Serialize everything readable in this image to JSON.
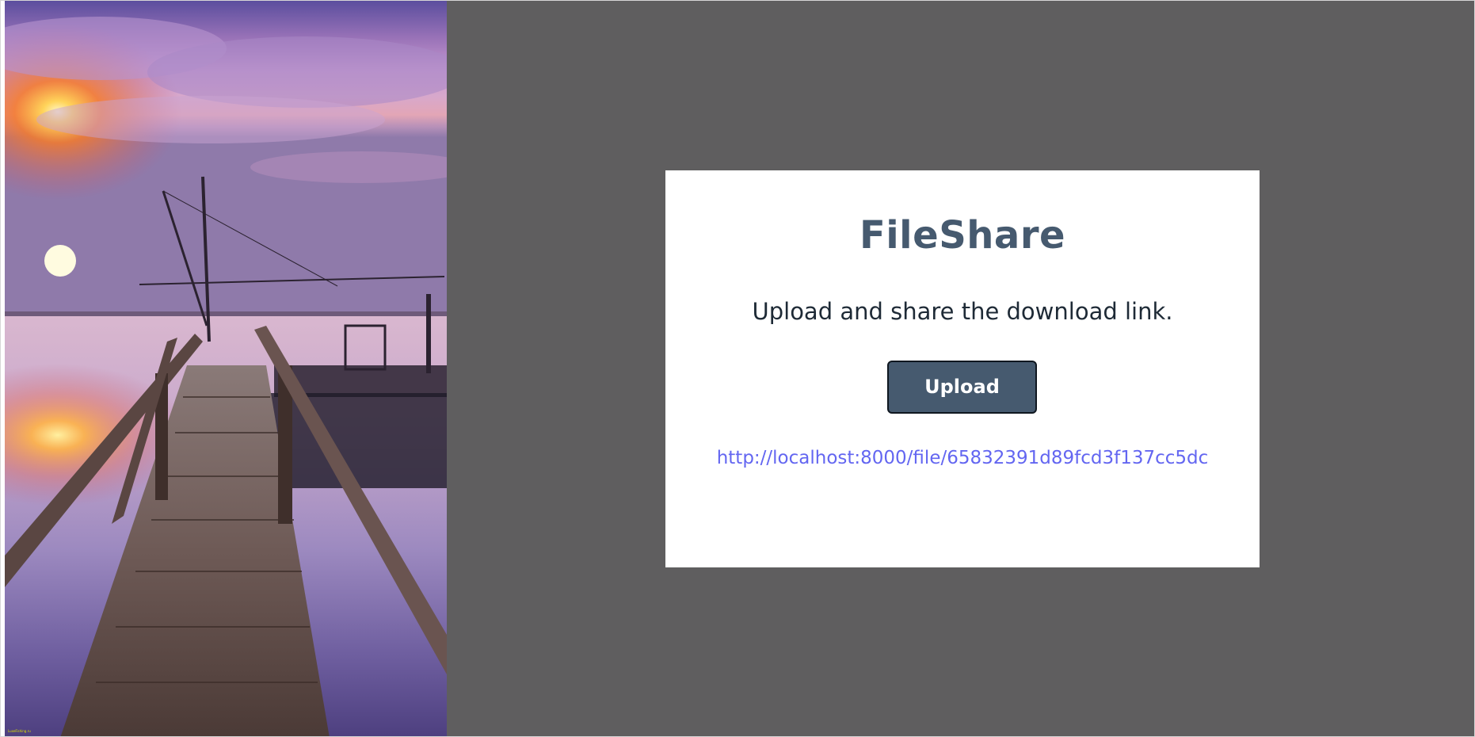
{
  "app": {
    "title": "FileShare"
  },
  "card": {
    "title": "FileShare",
    "subtitle": "Upload and share the download link.",
    "upload_label": "Upload",
    "download_link": "http://localhost:8000/file/65832391d89fcd3f137cc5dc"
  },
  "hero_image": {
    "description_icon": "sunset-pier-image",
    "watermark": "LuxeFishing.ru"
  },
  "colors": {
    "background_panel": "#5f5e5f",
    "card_background": "#ffffff",
    "title": "#465a6f",
    "button": "#465a6f",
    "link": "#6366f1"
  }
}
